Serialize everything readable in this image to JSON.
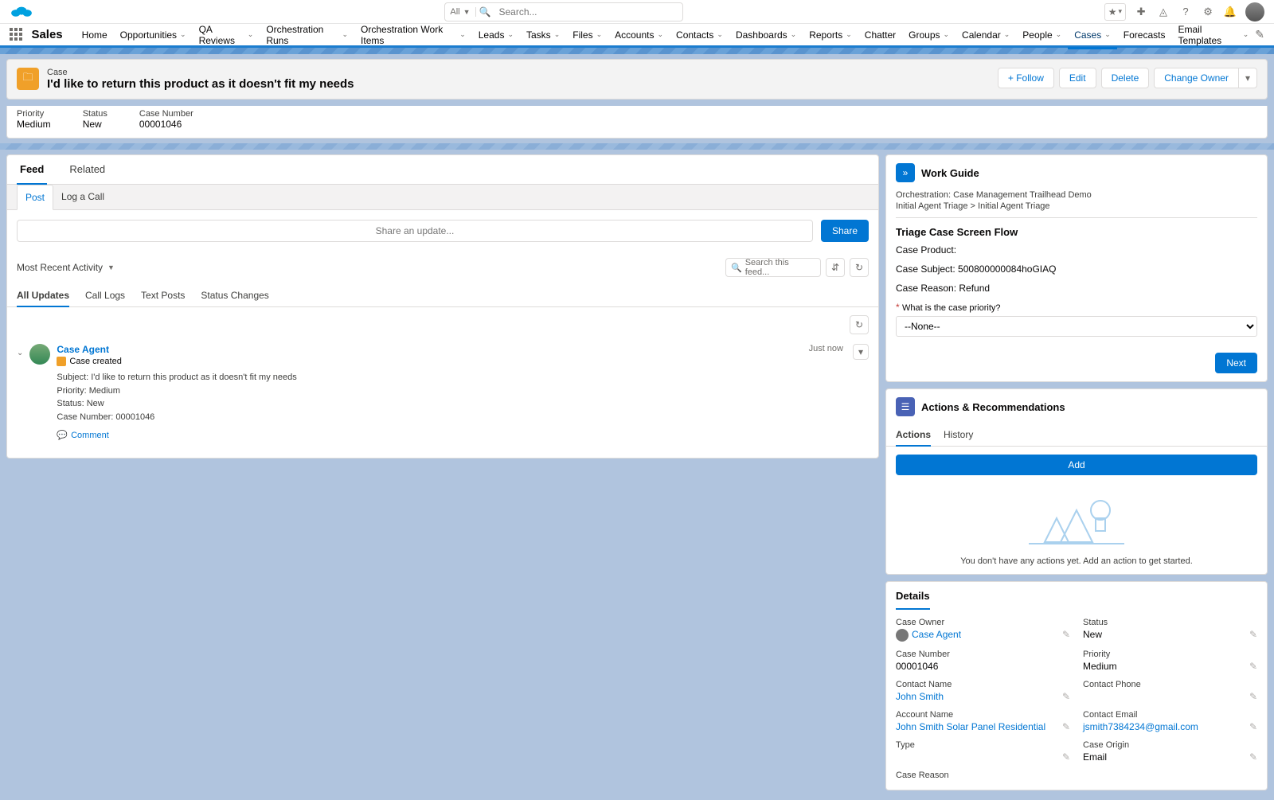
{
  "globalHeader": {
    "searchScope": "All",
    "searchPlaceholder": "Search..."
  },
  "nav": {
    "appName": "Sales",
    "items": [
      {
        "label": "Home",
        "menu": false,
        "active": false
      },
      {
        "label": "Opportunities",
        "menu": true,
        "active": false
      },
      {
        "label": "QA Reviews",
        "menu": true,
        "active": false
      },
      {
        "label": "Orchestration Runs",
        "menu": true,
        "active": false
      },
      {
        "label": "Orchestration Work Items",
        "menu": true,
        "active": false
      },
      {
        "label": "Leads",
        "menu": true,
        "active": false
      },
      {
        "label": "Tasks",
        "menu": true,
        "active": false
      },
      {
        "label": "Files",
        "menu": true,
        "active": false
      },
      {
        "label": "Accounts",
        "menu": true,
        "active": false
      },
      {
        "label": "Contacts",
        "menu": true,
        "active": false
      },
      {
        "label": "Dashboards",
        "menu": true,
        "active": false
      },
      {
        "label": "Reports",
        "menu": true,
        "active": false
      },
      {
        "label": "Chatter",
        "menu": false,
        "active": false
      },
      {
        "label": "Groups",
        "menu": true,
        "active": false
      },
      {
        "label": "Calendar",
        "menu": true,
        "active": false
      },
      {
        "label": "People",
        "menu": true,
        "active": false
      },
      {
        "label": "Cases",
        "menu": true,
        "active": true
      },
      {
        "label": "Forecasts",
        "menu": false,
        "active": false
      },
      {
        "label": "Email Templates",
        "menu": true,
        "active": false
      }
    ]
  },
  "highlights": {
    "objectLabel": "Case",
    "title": "I'd like to return this product as it doesn't fit my needs",
    "actions": {
      "follow": "Follow",
      "edit": "Edit",
      "delete": "Delete",
      "changeOwner": "Change Owner"
    },
    "fields": [
      {
        "label": "Priority",
        "value": "Medium"
      },
      {
        "label": "Status",
        "value": "New"
      },
      {
        "label": "Case Number",
        "value": "00001046"
      }
    ]
  },
  "feed": {
    "tabs": {
      "feed": "Feed",
      "related": "Related"
    },
    "publisherTabs": {
      "post": "Post",
      "logACall": "Log a Call"
    },
    "sharePlaceholder": "Share an update...",
    "shareBtn": "Share",
    "sort": "Most Recent Activity",
    "searchPlaceholder": "Search this feed...",
    "subTabs": {
      "all": "All Updates",
      "call": "Call Logs",
      "text": "Text Posts",
      "status": "Status Changes"
    },
    "item": {
      "author": "Case Agent",
      "recordEvent": "Case created",
      "timestamp": "Just now",
      "body": {
        "subject": "Subject: I'd like to return this product as it doesn't fit my needs",
        "priority": "Priority: Medium",
        "status": "Status: New",
        "caseNumber": "Case Number: 00001046"
      },
      "commentAction": "Comment"
    }
  },
  "workGuide": {
    "title": "Work Guide",
    "orchestration": "Orchestration: Case Management Trailhead Demo",
    "breadcrumb": "Initial Agent Triage > Initial Agent Triage",
    "flowTitle": "Triage Case Screen Flow",
    "caseProduct": "Case Product:",
    "caseSubject": "Case Subject: 500800000084hoGIAQ",
    "caseReason": "Case Reason: Refund",
    "priorityQuestion": "What is the case priority?",
    "prioritySelected": "--None--",
    "next": "Next"
  },
  "actionsRec": {
    "title": "Actions & Recommendations",
    "tabs": {
      "actions": "Actions",
      "history": "History"
    },
    "addBtn": "Add",
    "emptyMsg": "You don't have any actions yet. Add an action to get started."
  },
  "details": {
    "tab": "Details",
    "fields": {
      "caseOwner": {
        "label": "Case Owner",
        "value": "Case Agent"
      },
      "status": {
        "label": "Status",
        "value": "New"
      },
      "caseNumber": {
        "label": "Case Number",
        "value": "00001046"
      },
      "priority": {
        "label": "Priority",
        "value": "Medium"
      },
      "contactName": {
        "label": "Contact Name",
        "value": "John Smith"
      },
      "contactPhone": {
        "label": "Contact Phone",
        "value": ""
      },
      "accountName": {
        "label": "Account Name",
        "value": "John Smith Solar Panel Residential"
      },
      "contactEmail": {
        "label": "Contact Email",
        "value": "jsmith7384234@gmail.com"
      },
      "type": {
        "label": "Type",
        "value": ""
      },
      "caseOrigin": {
        "label": "Case Origin",
        "value": "Email"
      },
      "caseReason": {
        "label": "Case Reason",
        "value": ""
      }
    }
  }
}
